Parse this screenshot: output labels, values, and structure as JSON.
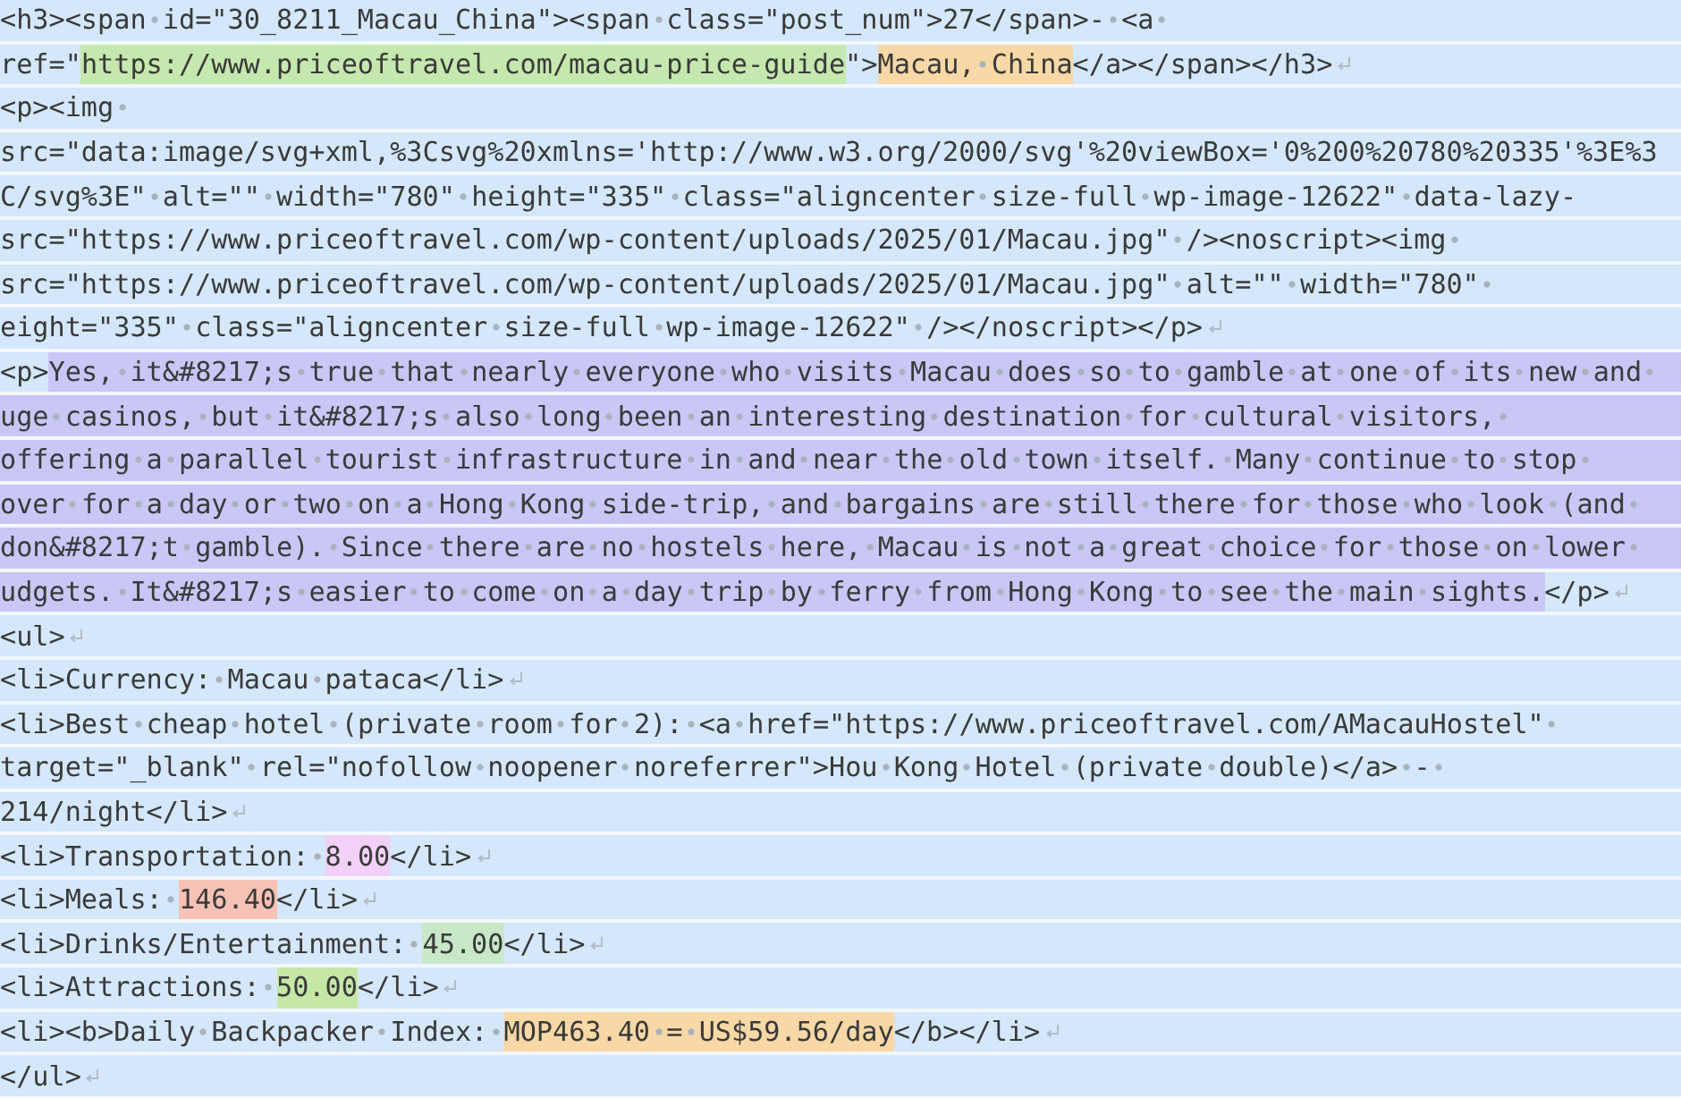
{
  "editor": {
    "lines": [
      {
        "hard_break": false,
        "segments": [
          {
            "text": "<h3><span id=\"30_8211_Macau_China\"><span class=\"post_num\">27</span>- <a "
          }
        ]
      },
      {
        "hard_break": true,
        "segments": [
          {
            "text": "ref=\""
          },
          {
            "text": "https://www.priceoftravel.com/macau-price-guide",
            "color": "#c5e8ae"
          },
          {
            "text": "\">"
          },
          {
            "text": "Macau, China",
            "color": "#f7d8a6"
          },
          {
            "text": "</a></span></h3>"
          }
        ]
      },
      {
        "hard_break": false,
        "segments": [
          {
            "text": "<p><img "
          }
        ]
      },
      {
        "hard_break": false,
        "segments": [
          {
            "text": "src=\"data:image/svg+xml,%3Csvg%20xmlns='http://www.w3.org/2000/svg'%20viewBox='0%200%20780%20335'%3E%3"
          }
        ]
      },
      {
        "hard_break": false,
        "segments": [
          {
            "text": "C/svg%3E\" alt=\"\" width=\"780\" height=\"335\" class=\"aligncenter size-full wp-image-12622\" data-lazy-"
          }
        ]
      },
      {
        "hard_break": false,
        "segments": [
          {
            "text": "src=\"https://www.priceoftravel.com/wp-content/uploads/2025/01/Macau.jpg\" /><noscript><img "
          }
        ]
      },
      {
        "hard_break": false,
        "segments": [
          {
            "text": "src=\"https://www.priceoftravel.com/wp-content/uploads/2025/01/Macau.jpg\" alt=\"\" width=\"780\" "
          }
        ]
      },
      {
        "hard_break": true,
        "segments": [
          {
            "text": "eight=\"335\" class=\"aligncenter size-full wp-image-12622\" /></noscript></p>"
          }
        ]
      },
      {
        "hard_break": false,
        "segments": [
          {
            "text": "<p>"
          },
          {
            "text": "Yes, it&#8217;s true that nearly everyone who visits Macau does so to gamble at one of its new and ",
            "color": "#c8c7f6"
          }
        ]
      },
      {
        "hard_break": false,
        "segments": [
          {
            "text": "uge casinos, but it&#8217;s also long been an interesting destination for cultural visitors, ",
            "color": "#c8c7f6"
          }
        ]
      },
      {
        "hard_break": false,
        "segments": [
          {
            "text": "offering a parallel tourist infrastructure in and near the old town itself. Many continue to stop ",
            "color": "#c8c7f6"
          }
        ]
      },
      {
        "hard_break": false,
        "segments": [
          {
            "text": "over for a day or two on a Hong Kong side-trip, and bargains are still there for those who look (and ",
            "color": "#c8c7f6"
          }
        ]
      },
      {
        "hard_break": false,
        "segments": [
          {
            "text": "don&#8217;t gamble). Since there are no hostels here, Macau is not a great choice for those on lower ",
            "color": "#c8c7f6"
          }
        ]
      },
      {
        "hard_break": true,
        "segments": [
          {
            "text": "udgets. It&#8217;s easier to come on a day trip by ferry from Hong Kong to see the main sights.",
            "color": "#c8c7f6"
          },
          {
            "text": "</p>"
          }
        ]
      },
      {
        "hard_break": true,
        "segments": [
          {
            "text": "<ul>"
          }
        ]
      },
      {
        "hard_break": true,
        "segments": [
          {
            "text": "<li>Currency: Macau pataca</li>"
          }
        ]
      },
      {
        "hard_break": false,
        "segments": [
          {
            "text": "<li>Best cheap hotel (private room for 2): <a href=\"https://www.priceoftravel.com/AMacauHostel\" "
          }
        ]
      },
      {
        "hard_break": false,
        "segments": [
          {
            "text": "target=\"_blank\" rel=\"nofollow noopener noreferrer\">Hou Kong Hotel (private double)</a> - "
          }
        ]
      },
      {
        "hard_break": true,
        "segments": [
          {
            "text": "214/night</li>"
          }
        ]
      },
      {
        "hard_break": true,
        "segments": [
          {
            "text": "<li>Transportation: "
          },
          {
            "text": "8.00",
            "color": "#f1d1f6"
          },
          {
            "text": "</li>"
          }
        ]
      },
      {
        "hard_break": true,
        "segments": [
          {
            "text": "<li>Meals: "
          },
          {
            "text": "146.40",
            "color": "#f7c2b6"
          },
          {
            "text": "</li>"
          }
        ]
      },
      {
        "hard_break": true,
        "segments": [
          {
            "text": "<li>Drinks/Entertainment: "
          },
          {
            "text": "45.00",
            "color": "#c8e8c8"
          },
          {
            "text": "</li>"
          }
        ]
      },
      {
        "hard_break": true,
        "segments": [
          {
            "text": "<li>Attractions: "
          },
          {
            "text": "50.00",
            "color": "#c5e8a6"
          },
          {
            "text": "</li>"
          }
        ]
      },
      {
        "hard_break": true,
        "segments": [
          {
            "text": "<li><b>Daily Backpacker Index: "
          },
          {
            "text": "MOP463.40 = US$59.56/day",
            "color": "#f7d8a6"
          },
          {
            "text": "</b></li>"
          }
        ]
      },
      {
        "hard_break": true,
        "segments": [
          {
            "text": "</ul>"
          }
        ]
      }
    ]
  }
}
